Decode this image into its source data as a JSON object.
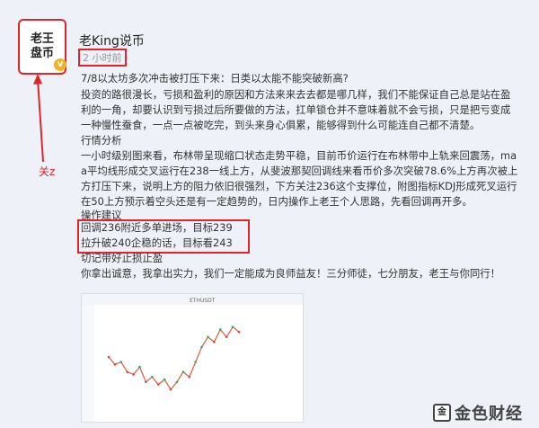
{
  "author": {
    "avatar_line1": "老王",
    "avatar_line2": "盘币",
    "name": "老King说币",
    "time": "2 小时前"
  },
  "annotation": "关z",
  "post": {
    "title": "7/8以太坊多次冲击被打压下来：日类以太能不能突破新高?",
    "intro": [
      "投资的路很漫长，亏损和盈利的原因和方法来来去去都是哪几样，我们不能保证自己总是站在盈",
      "利的一角，却要认识到亏损过后所要做的方法，扛单锁仓并不意味着就不会亏损，只是把亏变成",
      "一种慢性蚕食，一点一点被吃完，到头来身心俱累，能够得到什么可能连自己都不清楚。"
    ],
    "analysis_title": "行情分析",
    "analysis": [
      "一小时级别图来看，布林带呈现缩口状态走势平稳，目前币价运行在布林带中上轨来回震荡，ma",
      "a平均线形成交叉运行在238一线上方，从斐波那契回调线来看币价多次突破78.6%上方再次被上",
      "方打压下来，说明上方的阻力依旧很强烈，下方关注236这个支撑位，附图指标KDJ形成死叉运行",
      "在50上方预示着空头还是有一定趋势的，日内操作上老王个人思路，先看回调再开多。"
    ],
    "advice_title": "操作建议",
    "advice": [
      "回调236附近多单进场，目标239",
      "拉升破240企稳的话，目标看243"
    ],
    "stop_note": "切记带好止损止盈",
    "closing": "你拿出诚意，我拿出实力，我们一定能成为良师益友！三分师徒，七分朋友，老王与你同行！"
  },
  "chart_data": {
    "type": "line",
    "title": "ETHUSDT",
    "y": [
      231,
      229.5,
      230,
      228,
      227.5,
      229,
      226,
      227,
      225.5,
      226.5,
      224.5,
      226,
      228,
      227,
      230,
      233,
      235,
      234,
      236.5,
      235,
      237,
      236
    ],
    "ylim": [
      222,
      240
    ]
  },
  "watermark": {
    "text": "金色财经",
    "icon": "jinse-logo-icon"
  }
}
